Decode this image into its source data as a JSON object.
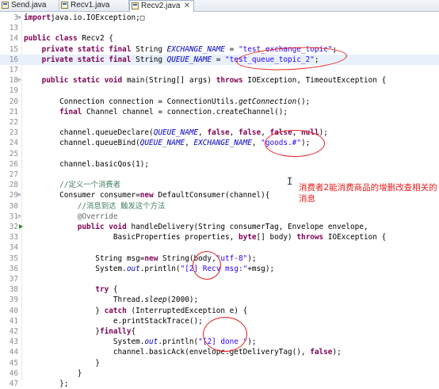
{
  "tabs": [
    {
      "label": "Send.java",
      "active": false
    },
    {
      "label": "Recv1.java",
      "active": false
    },
    {
      "label": "Recv2.java",
      "active": true,
      "close": "✕"
    }
  ],
  "lines": [
    {
      "n": "3",
      "fold": "⊕",
      "segs": [
        [
          "kw",
          "import"
        ],
        [
          "",
          "java.io.IOException;"
        ],
        [
          "",
          "□"
        ]
      ]
    },
    {
      "n": "13",
      "segs": []
    },
    {
      "n": "14",
      "segs": [
        [
          "kw",
          "public class"
        ],
        [
          "",
          " Recv2 {"
        ]
      ]
    },
    {
      "n": "15",
      "segs": [
        [
          "",
          "    "
        ],
        [
          "kw",
          "private static final"
        ],
        [
          "",
          " String "
        ],
        [
          "sfld",
          "EXCHANGE_NAME"
        ],
        [
          "",
          " = "
        ],
        [
          "str",
          "\"test_exchange_topic\""
        ],
        [
          "",
          ";"
        ]
      ]
    },
    {
      "n": "16",
      "hl": true,
      "segs": [
        [
          "",
          "    "
        ],
        [
          "kw",
          "private static final"
        ],
        [
          "",
          " String "
        ],
        [
          "sfld",
          "QUEUE_NAME"
        ],
        [
          "",
          " = "
        ],
        [
          "str",
          "\"test_queue_topic_2\""
        ],
        [
          "",
          ";"
        ]
      ]
    },
    {
      "n": "17",
      "segs": []
    },
    {
      "n": "18",
      "fold": "⊖",
      "segs": [
        [
          "",
          "    "
        ],
        [
          "kw",
          "public static void"
        ],
        [
          "",
          " main(String[] args) "
        ],
        [
          "kw",
          "throws"
        ],
        [
          "",
          " IOException, TimeoutException {"
        ]
      ]
    },
    {
      "n": "19",
      "segs": []
    },
    {
      "n": "20",
      "segs": [
        [
          "",
          "        Connection connection = ConnectionUtils."
        ],
        [
          "ital",
          "getConnection"
        ],
        [
          "",
          "();"
        ]
      ]
    },
    {
      "n": "21",
      "segs": [
        [
          "",
          "        "
        ],
        [
          "kw",
          "final"
        ],
        [
          "",
          " Channel channel = connection.createChannel();"
        ]
      ]
    },
    {
      "n": "22",
      "segs": []
    },
    {
      "n": "23",
      "segs": [
        [
          "",
          "        channel.queueDeclare("
        ],
        [
          "sfld",
          "QUEUE_NAME"
        ],
        [
          "",
          ", "
        ],
        [
          "kw",
          "false"
        ],
        [
          "",
          ", "
        ],
        [
          "kw",
          "false"
        ],
        [
          "",
          ", "
        ],
        [
          "kw",
          "false"
        ],
        [
          "",
          ", "
        ],
        [
          "kw",
          "null"
        ],
        [
          "",
          ");"
        ]
      ]
    },
    {
      "n": "24",
      "segs": [
        [
          "",
          "        channel.queueBind("
        ],
        [
          "sfld",
          "QUEUE_NAME"
        ],
        [
          "",
          ", "
        ],
        [
          "sfld",
          "EXCHANGE_NAME"
        ],
        [
          "",
          ", "
        ],
        [
          "str",
          "\"goods.#\""
        ],
        [
          "",
          ");"
        ]
      ]
    },
    {
      "n": "25",
      "segs": []
    },
    {
      "n": "26",
      "segs": [
        [
          "",
          "        channel.basicQos(1);"
        ]
      ]
    },
    {
      "n": "27",
      "segs": []
    },
    {
      "n": "28",
      "segs": [
        [
          "",
          "        "
        ],
        [
          "cm",
          "//定义一个消费者"
        ]
      ]
    },
    {
      "n": "29",
      "fold": "⊖",
      "segs": [
        [
          "",
          "        Consumer consumer="
        ],
        [
          "kw",
          "new"
        ],
        [
          "",
          " DefaultConsumer(channel){"
        ]
      ]
    },
    {
      "n": "30",
      "segs": [
        [
          "",
          "            "
        ],
        [
          "cm",
          "//消息到达 触发这个方法"
        ]
      ]
    },
    {
      "n": "31",
      "fold": "⊖",
      "segs": [
        [
          "",
          "            "
        ],
        [
          "ann",
          "@Override"
        ]
      ]
    },
    {
      "n": "32",
      "ovr": true,
      "segs": [
        [
          "",
          "            "
        ],
        [
          "kw",
          "public void"
        ],
        [
          "",
          " handleDelivery(String consumerTag, Envelope envelope,"
        ]
      ]
    },
    {
      "n": "33",
      "segs": [
        [
          "",
          "                    BasicProperties properties, "
        ],
        [
          "kw",
          "byte"
        ],
        [
          "",
          "[] body) "
        ],
        [
          "kw",
          "throws"
        ],
        [
          "",
          " IOException {"
        ]
      ]
    },
    {
      "n": "34",
      "segs": []
    },
    {
      "n": "35",
      "segs": [
        [
          "",
          "                String msg="
        ],
        [
          "kw",
          "new"
        ],
        [
          "",
          " String(body,"
        ],
        [
          "str",
          "\"utf-8\""
        ],
        [
          "",
          ");"
        ]
      ]
    },
    {
      "n": "36",
      "segs": [
        [
          "",
          "                System."
        ],
        [
          "fld",
          "out"
        ],
        [
          "",
          ".println("
        ],
        [
          "str",
          "\"[2] Recv msg:\""
        ],
        [
          "",
          "+msg);"
        ]
      ]
    },
    {
      "n": "37",
      "segs": []
    },
    {
      "n": "38",
      "segs": [
        [
          "",
          "                "
        ],
        [
          "kw",
          "try"
        ],
        [
          "",
          " {"
        ]
      ]
    },
    {
      "n": "39",
      "segs": [
        [
          "",
          "                    Thread."
        ],
        [
          "ital",
          "sleep"
        ],
        [
          "",
          "(2000);"
        ]
      ]
    },
    {
      "n": "40",
      "segs": [
        [
          "",
          "                } "
        ],
        [
          "kw",
          "catch"
        ],
        [
          "",
          " (InterruptedException e) {"
        ]
      ]
    },
    {
      "n": "41",
      "segs": [
        [
          "",
          "                    e.printStackTrace();"
        ]
      ]
    },
    {
      "n": "42",
      "segs": [
        [
          "",
          "                }"
        ],
        [
          "kw",
          "finally"
        ],
        [
          "",
          "{"
        ]
      ]
    },
    {
      "n": "43",
      "segs": [
        [
          "",
          "                    System."
        ],
        [
          "fld",
          "out"
        ],
        [
          "",
          ".println("
        ],
        [
          "str",
          "\"[2] done \""
        ],
        [
          "",
          ");"
        ]
      ]
    },
    {
      "n": "44",
      "segs": [
        [
          "",
          "                    channel.basicAck(envelope.getDeliveryTag(), "
        ],
        [
          "kw",
          "false"
        ],
        [
          "",
          ");"
        ]
      ]
    },
    {
      "n": "45",
      "segs": [
        [
          "",
          "                }"
        ]
      ]
    },
    {
      "n": "46",
      "segs": [
        [
          "",
          "            }"
        ]
      ]
    },
    {
      "n": "47",
      "segs": [
        [
          "",
          "        };"
        ]
      ]
    }
  ],
  "annotation": {
    "text": "消费者2能消费商品的增删改查相关的消息",
    "color": "#e81a1a"
  },
  "cursor_glyph": "I",
  "colors": {
    "keyword": "#7f0055",
    "string": "#2a00ff",
    "field": "#0000c0",
    "comment": "#3f7f5f",
    "highlight_line": "#e8f0fb",
    "markup_red": "#e02020"
  }
}
